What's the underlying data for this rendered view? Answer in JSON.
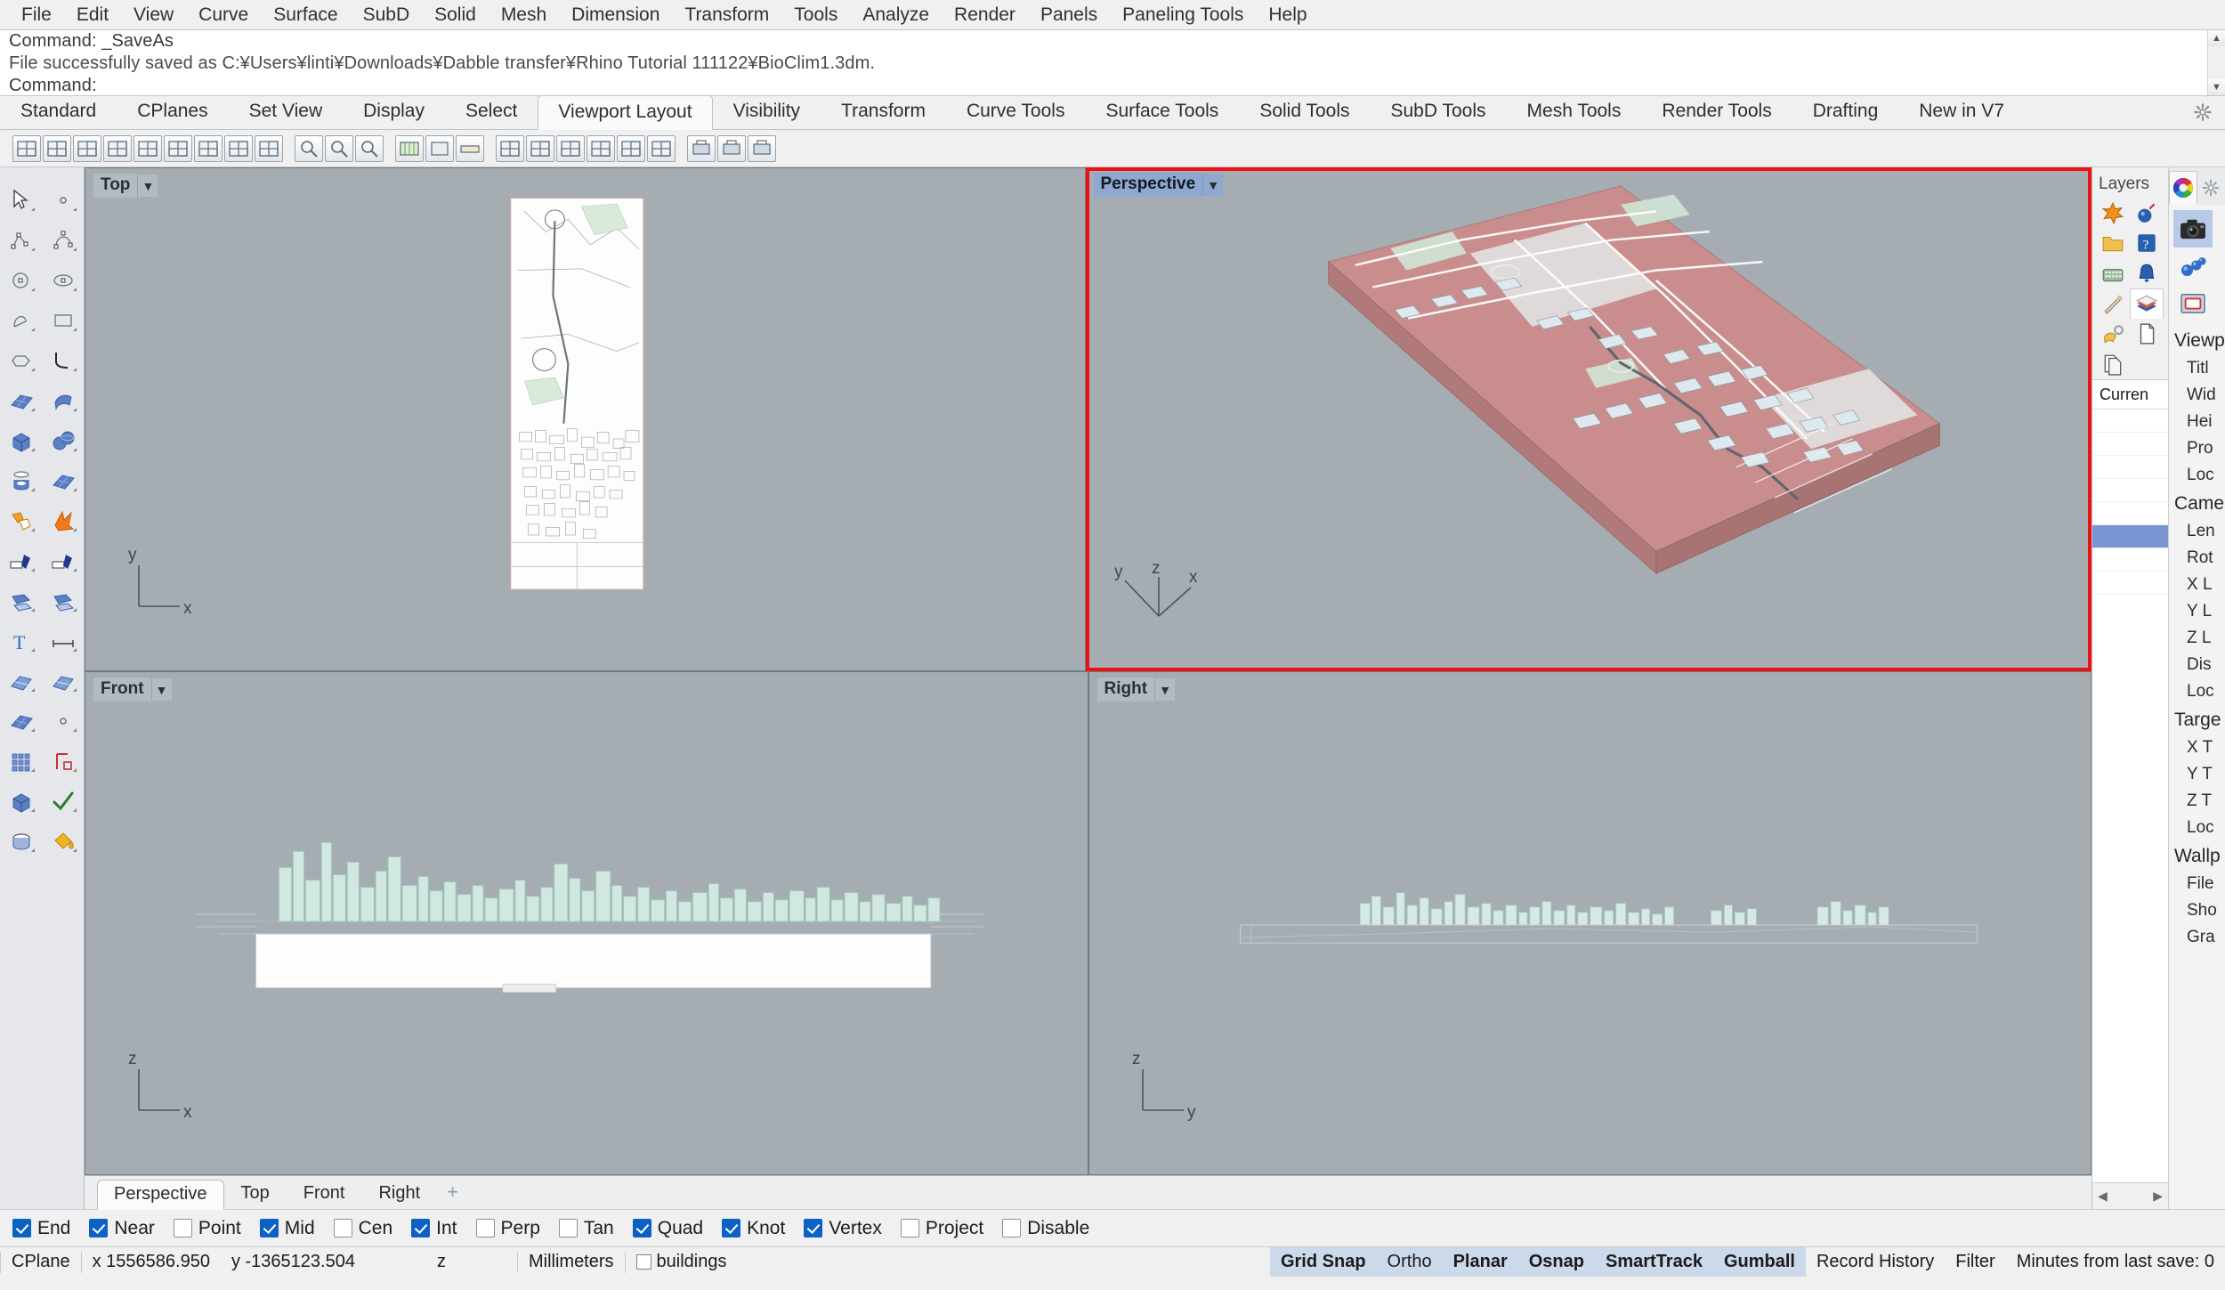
{
  "menubar": {
    "items": [
      {
        "label": "File"
      },
      {
        "label": "Edit"
      },
      {
        "label": "View"
      },
      {
        "label": "Curve"
      },
      {
        "label": "Surface"
      },
      {
        "label": "SubD"
      },
      {
        "label": "Solid"
      },
      {
        "label": "Mesh"
      },
      {
        "label": "Dimension"
      },
      {
        "label": "Transform"
      },
      {
        "label": "Tools"
      },
      {
        "label": "Analyze"
      },
      {
        "label": "Render"
      },
      {
        "label": "Panels"
      },
      {
        "label": "Paneling Tools"
      },
      {
        "label": "Help"
      }
    ]
  },
  "command_area": {
    "line1": "Command: _SaveAs",
    "line2": "File successfully saved as C:¥Users¥linti¥Downloads¥Dabble transfer¥Rhino Tutorial 111122¥BioClim1.3dm.",
    "line3": "Command:",
    "prompt_label": "Command:",
    "scroll_up": "▲",
    "scroll_down": "▼"
  },
  "toolbar_tabs": {
    "active": "Viewport Layout",
    "items": [
      {
        "label": "Standard"
      },
      {
        "label": "CPlanes"
      },
      {
        "label": "Set View"
      },
      {
        "label": "Display"
      },
      {
        "label": "Select"
      },
      {
        "label": "Viewport Layout"
      },
      {
        "label": "Visibility"
      },
      {
        "label": "Transform"
      },
      {
        "label": "Curve Tools"
      },
      {
        "label": "Surface Tools"
      },
      {
        "label": "Solid Tools"
      },
      {
        "label": "SubD Tools"
      },
      {
        "label": "Mesh Tools"
      },
      {
        "label": "Render Tools"
      },
      {
        "label": "Drafting"
      },
      {
        "label": "New in V7"
      }
    ],
    "options_icon": "gear-icon"
  },
  "icon_toolbar": {
    "icons": [
      "viewport-single-icon",
      "viewport-split-v-icon",
      "viewport-split-h-icon",
      "viewport-four-icon",
      "viewport-three-icon",
      "viewport-tile-icon",
      "viewport-two-h-icon",
      "viewport-two-v-icon",
      "viewport-arrange-icon",
      "zoom-extents-icon",
      "zoom-window-icon",
      "zoom-selected-icon",
      "grid-icon",
      "named-view-icon",
      "ruler-icon",
      "new-viewport-icon",
      "sync-views-icon",
      "maximize-viewport-icon",
      "restore-viewport-icon",
      "float-viewport-icon",
      "titled-viewport-icon",
      "print-icon",
      "fullscreen-icon",
      "capture-icon"
    ]
  },
  "left_palette": {
    "icons": [
      "select-arrow-icon",
      "point-icon",
      "polyline-icon",
      "arc-icon",
      "circle-icon",
      "ellipse-icon",
      "curve-icon",
      "rectangle-icon",
      "polygon-icon",
      "fillet-curve-icon",
      "surface-from-curves-icon",
      "extrude-surface-icon",
      "box-icon",
      "sphere-icon",
      "cylinder-icon",
      "plane-surface-icon",
      "boolean-union-icon",
      "explode-icon",
      "trim-icon",
      "split-icon",
      "fillet-surface-icon",
      "offset-icon",
      "text-icon",
      "dimension-icon",
      "loft-icon",
      "sweep-icon",
      "mesh-icon",
      "point-cloud-icon",
      "array-icon",
      "scale-icon",
      "extrude-solid-icon",
      "check-icon",
      "cap-icon",
      "paint-bucket-icon"
    ]
  },
  "viewports": [
    {
      "name": "Top",
      "label": "Top",
      "active": false,
      "annotated": false,
      "axes": [
        "y",
        "x"
      ],
      "caret": "▼"
    },
    {
      "name": "Perspective",
      "label": "Perspective",
      "active": true,
      "annotated": true,
      "axes": [
        "y",
        "z",
        "x"
      ],
      "caret": "▼"
    },
    {
      "name": "Front",
      "label": "Front",
      "active": false,
      "annotated": false,
      "axes": [
        "z",
        "x"
      ],
      "caret": "▼"
    },
    {
      "name": "Right",
      "label": "Right",
      "active": false,
      "annotated": false,
      "axes": [
        "z",
        "y"
      ],
      "caret": "▼"
    }
  ],
  "viewport_tabs": {
    "active": "Perspective",
    "items": [
      {
        "label": "Perspective"
      },
      {
        "label": "Top"
      },
      {
        "label": "Front"
      },
      {
        "label": "Right"
      }
    ],
    "add_label": "+"
  },
  "layers_panel": {
    "title": "Layers",
    "icons": [
      "new-layer-icon",
      "delete-layer-icon",
      "folder-icon",
      "layer-properties-icon",
      "keyboard-icon",
      "notification-icon",
      "eyedropper-icon",
      "layers-stack-icon",
      "layer-settings-icon",
      "page-icon",
      "copy-page-icon"
    ],
    "column_header": "Curren",
    "row_count": 8,
    "selected_row_index": 5,
    "footer_left": "◀",
    "footer_right": "▶"
  },
  "properties_panel": {
    "tabs": [
      "color-wheel-icon",
      "gear-icon"
    ],
    "active_tab": "color-wheel-icon",
    "side_icons": [
      "camera-icon",
      "render-mesh-icon",
      "viewport-frame-icon"
    ],
    "selected_side_icon": "camera-icon",
    "groups": [
      {
        "label": "Viewp",
        "items": [
          "Titl",
          "Wid",
          "Hei",
          "Pro",
          "Loc"
        ]
      },
      {
        "label": "Came",
        "items": [
          "Len",
          "Rot",
          "X L",
          "Y L",
          "Z L",
          "Dis",
          "Loc"
        ]
      },
      {
        "label": "Targe",
        "items": [
          "X T",
          "Y T",
          "Z T",
          "Loc"
        ]
      },
      {
        "label": "Wallp",
        "items": [
          "File",
          "Sho",
          "Gra"
        ]
      }
    ]
  },
  "osnaps": [
    {
      "label": "End",
      "checked": true
    },
    {
      "label": "Near",
      "checked": true
    },
    {
      "label": "Point",
      "checked": false
    },
    {
      "label": "Mid",
      "checked": true
    },
    {
      "label": "Cen",
      "checked": false
    },
    {
      "label": "Int",
      "checked": true
    },
    {
      "label": "Perp",
      "checked": false
    },
    {
      "label": "Tan",
      "checked": false
    },
    {
      "label": "Quad",
      "checked": true
    },
    {
      "label": "Knot",
      "checked": true
    },
    {
      "label": "Vertex",
      "checked": true
    },
    {
      "label": "Project",
      "checked": false
    },
    {
      "label": "Disable",
      "checked": false
    }
  ],
  "statusbar": {
    "cplane_label": "CPlane",
    "x_value": "x 1556586.950",
    "y_value": "y -1365123.504",
    "z_value": "z",
    "units": "Millimeters",
    "layer": "buildings",
    "toggles": [
      {
        "label": "Grid Snap",
        "on": true
      },
      {
        "label": "Ortho",
        "on": false
      },
      {
        "label": "Planar",
        "on": true
      },
      {
        "label": "Osnap",
        "on": true
      },
      {
        "label": "SmartTrack",
        "on": true
      },
      {
        "label": "Gumball",
        "on": true
      }
    ],
    "plain": [
      {
        "label": "Record History"
      },
      {
        "label": "Filter"
      },
      {
        "label": "Minutes from last save: 0"
      }
    ]
  },
  "colors": {
    "accent_red": "#ee1111",
    "active_viewport_label": "#8fa8cf",
    "osnap_checked": "#0b62c4",
    "viewport_bg": "#a5adb3",
    "model_pink": "#c98d8d",
    "model_green": "#c9e4d4"
  }
}
